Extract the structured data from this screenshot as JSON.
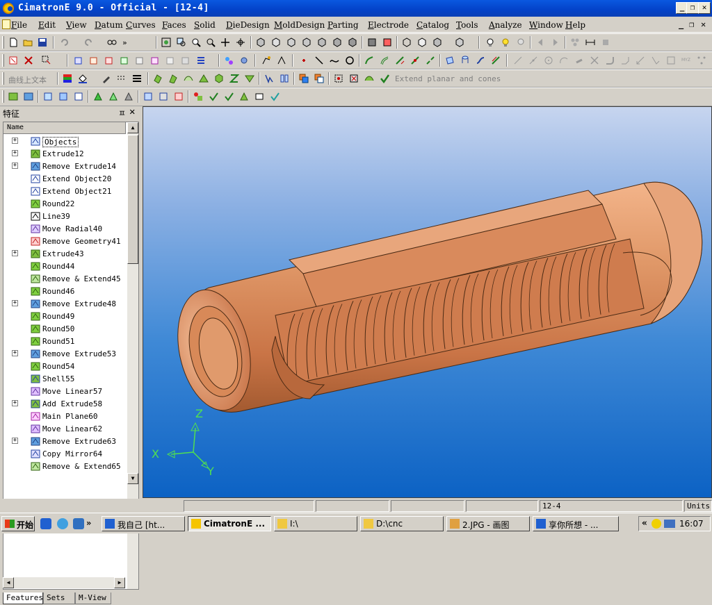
{
  "window": {
    "title": "CimatronE 9.0 - Official - [12-4]",
    "buttons": [
      "_",
      "❐",
      "✕"
    ]
  },
  "menubar": {
    "items": [
      "File",
      "Edit",
      "View",
      "Datum",
      "Curves",
      "Faces",
      "Solid",
      "DieDesign",
      "MoldDesign",
      "Parting",
      "Electrode",
      "Catalog",
      "Tools",
      "Analyze",
      "Window",
      "Help"
    ],
    "mdi_buttons": [
      "_",
      "❐",
      "✕"
    ]
  },
  "toolbars": {
    "curve_text_label": "曲线上文本",
    "extend_label": "Extend planar and cones"
  },
  "feature_panel": {
    "title": "特征",
    "pin": "ㅍ",
    "close": "✕",
    "column_header": "Name",
    "items": [
      {
        "label": "Objects",
        "icon": "objects-icon",
        "expandable": true,
        "selected": true
      },
      {
        "label": "Extrude12",
        "icon": "extrude-icon",
        "expandable": true
      },
      {
        "label": "Remove Extrude14",
        "icon": "remove-extrude-icon",
        "expandable": true
      },
      {
        "label": "Extend Object20",
        "icon": "extend-object-icon",
        "expandable": false
      },
      {
        "label": "Extend Object21",
        "icon": "extend-object-icon",
        "expandable": false
      },
      {
        "label": "Round22",
        "icon": "round-icon",
        "expandable": false
      },
      {
        "label": "Line39",
        "icon": "line-icon",
        "expandable": false
      },
      {
        "label": "Move Radial40",
        "icon": "move-radial-icon",
        "expandable": false
      },
      {
        "label": "Remove Geometry41",
        "icon": "remove-geometry-icon",
        "expandable": false
      },
      {
        "label": "Extrude43",
        "icon": "extrude-icon",
        "expandable": true
      },
      {
        "label": "Round44",
        "icon": "round-icon",
        "expandable": false
      },
      {
        "label": "Remove & Extend45",
        "icon": "remove-extend-icon",
        "expandable": false
      },
      {
        "label": "Round46",
        "icon": "round-icon",
        "expandable": false
      },
      {
        "label": "Remove Extrude48",
        "icon": "remove-extrude-icon",
        "expandable": true
      },
      {
        "label": "Round49",
        "icon": "round-icon",
        "expandable": false
      },
      {
        "label": "Round50",
        "icon": "round-icon",
        "expandable": false
      },
      {
        "label": "Round51",
        "icon": "round-icon",
        "expandable": false
      },
      {
        "label": "Remove Extrude53",
        "icon": "remove-extrude-icon",
        "expandable": true
      },
      {
        "label": "Round54",
        "icon": "round-icon",
        "expandable": false
      },
      {
        "label": "Shell55",
        "icon": "shell-icon",
        "expandable": false
      },
      {
        "label": "Move Linear57",
        "icon": "move-linear-icon",
        "expandable": false
      },
      {
        "label": "Add Extrude58",
        "icon": "add-extrude-icon",
        "expandable": true
      },
      {
        "label": "Main Plane60",
        "icon": "main-plane-icon",
        "expandable": false
      },
      {
        "label": "Move Linear62",
        "icon": "move-linear-icon",
        "expandable": false
      },
      {
        "label": "Remove Extrude63",
        "icon": "remove-extrude-icon",
        "expandable": true
      },
      {
        "label": "Copy Mirror64",
        "icon": "copy-mirror-icon",
        "expandable": false
      },
      {
        "label": "Remove & Extend65",
        "icon": "remove-extend-icon",
        "expandable": false
      }
    ],
    "tabs": [
      "Features",
      "Sets",
      "M-View"
    ],
    "active_tab": "Features"
  },
  "viewport": {
    "axes": {
      "x": "X",
      "y": "Y",
      "z": "Z"
    },
    "model_color": "#d9895a",
    "axis_color": "#50e050"
  },
  "statusbar": {
    "cells": [
      "",
      "",
      "",
      "",
      "12-4",
      "Units:"
    ]
  },
  "taskbar": {
    "start_label": "开始",
    "tasks": [
      {
        "label": "我自己 [ht...",
        "icon": "browser-icon",
        "active": false
      },
      {
        "label": "CimatronE ...",
        "icon": "cimatron-icon",
        "active": true
      },
      {
        "label": "I:\\",
        "icon": "folder-icon",
        "active": false
      },
      {
        "label": "D:\\cnc",
        "icon": "folder-icon",
        "active": false
      },
      {
        "label": "2.JPG - 画图",
        "icon": "paint-icon",
        "active": false
      },
      {
        "label": "享你所想 - ...",
        "icon": "browser-icon",
        "active": false
      }
    ],
    "tray_expand": "«",
    "clock": "16:07"
  }
}
